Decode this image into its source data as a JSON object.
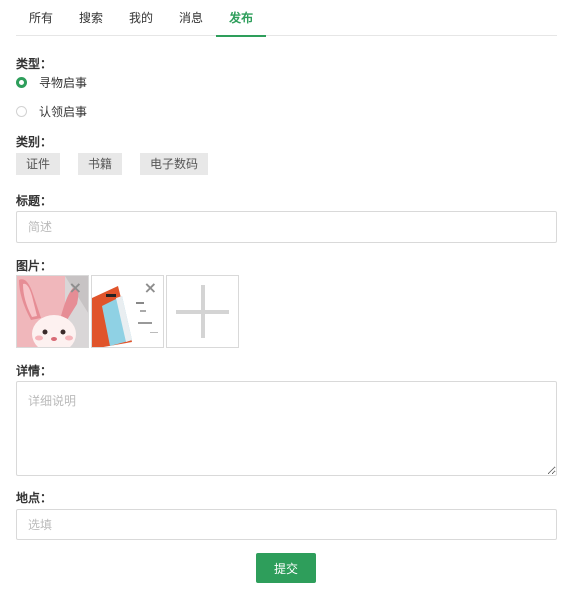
{
  "tabs": [
    {
      "label": "所有"
    },
    {
      "label": "搜索"
    },
    {
      "label": "我的"
    },
    {
      "label": "消息"
    },
    {
      "label": "发布",
      "active": true
    }
  ],
  "form": {
    "type_label": "类型：",
    "type_options": [
      {
        "label": "寻物启事",
        "checked": true
      },
      {
        "label": "认领启事",
        "checked": false
      }
    ],
    "category_label": "类别：",
    "categories": [
      "证件",
      "书籍",
      "电子数码"
    ],
    "title_label": "标题：",
    "title_placeholder": "简述",
    "images_label": "图片：",
    "images": [
      {
        "icon": "bunny-photo",
        "remove_icon": "×"
      },
      {
        "icon": "phone-photo",
        "remove_icon": "×"
      }
    ],
    "add_image_icon": "plus-icon",
    "detail_label": "详情：",
    "detail_placeholder": "详细说明",
    "location_label": "地点：",
    "location_placeholder": "选填",
    "submit_label": "提交"
  },
  "colors": {
    "accent": "#2e9e5b",
    "chip_bg": "#e8e8e8",
    "border": "#d9d9d9"
  }
}
